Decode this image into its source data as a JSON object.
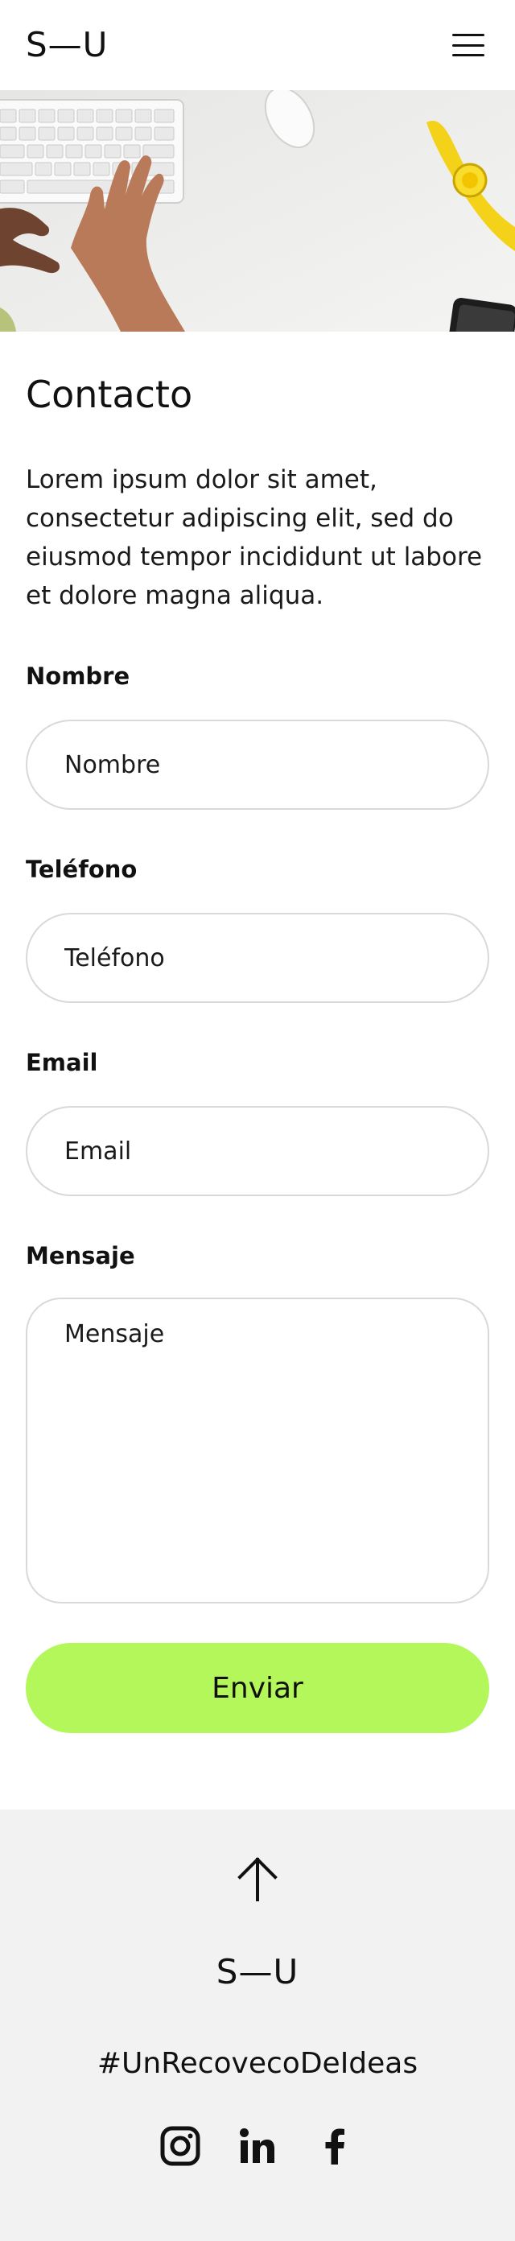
{
  "header": {
    "logo": "S—U",
    "menu_icon": "hamburger-menu-icon"
  },
  "hero": {
    "image": "photo of hands typing on a white keyboard with a yellow watch, mouse and phone on a white desk"
  },
  "content": {
    "title": "Contacto",
    "intro": "Lorem ipsum dolor sit amet, consectetur adipiscing elit, sed do eiusmod tempor incididunt ut labore et dolore magna aliqua."
  },
  "form": {
    "name": {
      "label": "Nombre",
      "placeholder": "Nombre",
      "value": ""
    },
    "phone": {
      "label": "Teléfono",
      "placeholder": "Teléfono",
      "value": ""
    },
    "email": {
      "label": "Email",
      "placeholder": "Email",
      "value": ""
    },
    "message": {
      "label": "Mensaje",
      "placeholder": "Mensaje",
      "value": ""
    },
    "submit_label": "Enviar"
  },
  "footer": {
    "to_top_icon": "arrow-up-icon",
    "logo": "S—U",
    "hashtag": "#UnRecovecoDeIdeas",
    "social": [
      "instagram-icon",
      "linkedin-icon",
      "facebook-icon"
    ]
  },
  "colors": {
    "accent": "#b3f75a",
    "footer_bg": "#f2f2f2",
    "text": "#111111",
    "border": "#d9d9d9"
  }
}
